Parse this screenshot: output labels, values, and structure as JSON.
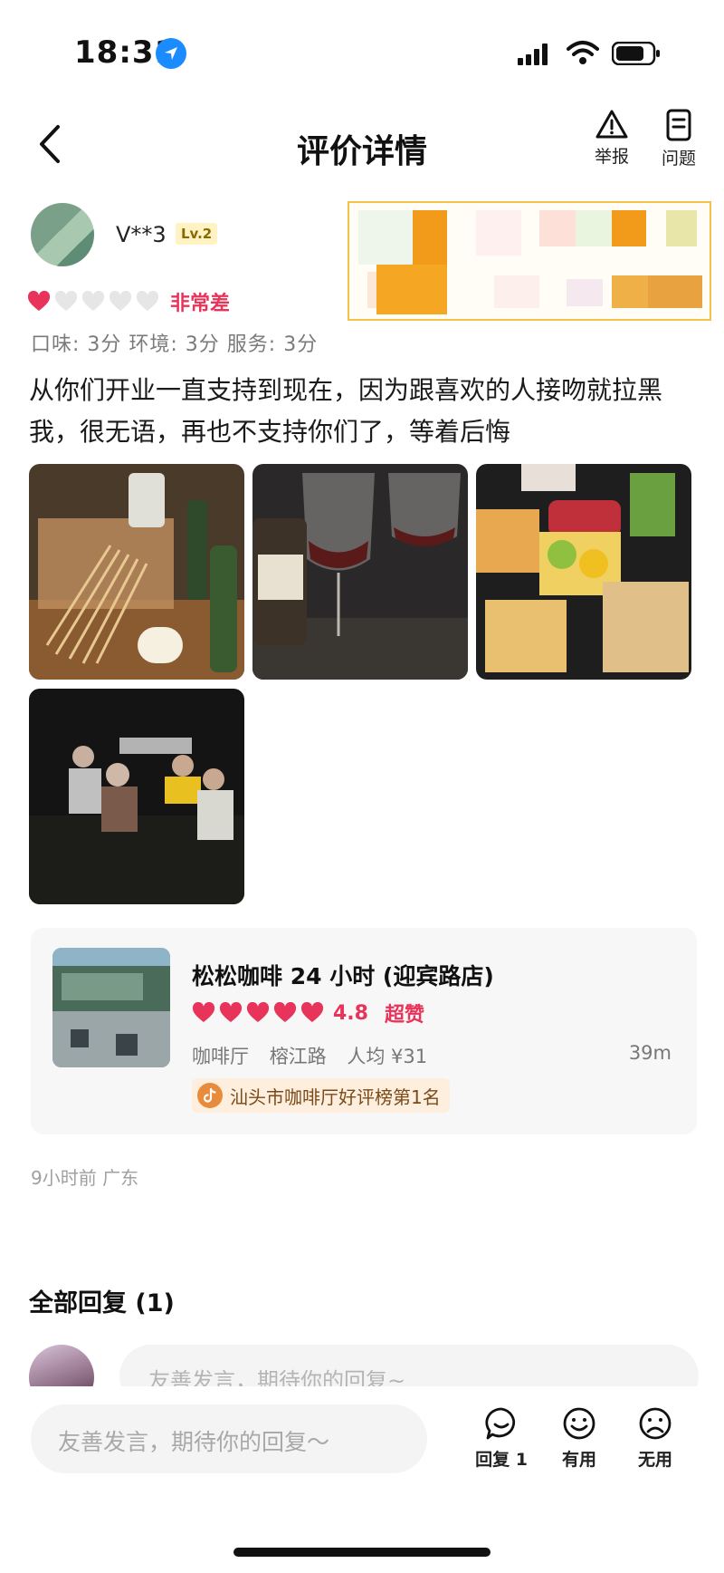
{
  "status_bar": {
    "time": "18:31"
  },
  "nav": {
    "title": "评价详情",
    "report_label": "举报",
    "question_label": "问题"
  },
  "author": {
    "name": "V**3",
    "level": "Lv.2"
  },
  "rating": {
    "hearts_filled": 1,
    "hearts_total": 5,
    "text": "非常差",
    "sub_scores": "口味: 3分  环境: 3分  服务: 3分"
  },
  "review": {
    "text": "从你们开业一直支持到现在，因为跟喜欢的人接吻就拉黑我，很无语，再也不支持你们了，等着后悔"
  },
  "shop": {
    "name": "松松咖啡 24 小时 (迎宾路店)",
    "hearts_filled": 5,
    "score": "4.8",
    "praise": "超赞",
    "category": "咖啡厅",
    "area": "榕江路",
    "avg_price": "人均 ¥31",
    "distance": "39m",
    "rank": "汕头市咖啡厅好评榜第1名"
  },
  "meta": {
    "time_location": "9小时前  广东"
  },
  "replies": {
    "title": "全部回复 (1)",
    "input_placeholder": "友善发言，期待你的回复~"
  },
  "bottom_bar": {
    "input_placeholder": "友善发言，期待你的回复～",
    "reply_label": "回复 1",
    "useful_label": "有用",
    "useless_label": "无用"
  },
  "colors": {
    "accent_red": "#e8345a",
    "heart_empty": "#e6e6e6"
  }
}
